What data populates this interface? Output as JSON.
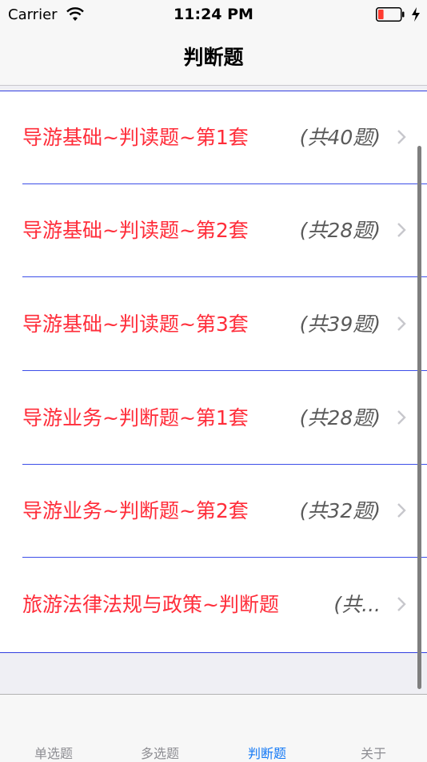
{
  "status_bar": {
    "carrier": "Carrier",
    "time": "11:24 PM",
    "battery_level": 0.25,
    "battery_color": "#ff3b30"
  },
  "nav": {
    "title": "判断题"
  },
  "list": {
    "items": [
      {
        "title": "导游基础~判读题~第1套",
        "count": "(共40题)"
      },
      {
        "title": "导游基础~判读题~第2套",
        "count": "(共28题)"
      },
      {
        "title": "导游基础~判读题~第3套",
        "count": "(共39题)"
      },
      {
        "title": "导游业务~判断题~第1套",
        "count": "(共28题)"
      },
      {
        "title": "导游业务~判断题~第2套",
        "count": "(共32题)"
      },
      {
        "title": "旅游法律法规与政策~判断题",
        "count": "(共..."
      }
    ]
  },
  "tabs": [
    {
      "label": "单选题",
      "active": false
    },
    {
      "label": "多选题",
      "active": false
    },
    {
      "label": "判断题",
      "active": true
    },
    {
      "label": "关于",
      "active": false
    }
  ],
  "colors": {
    "title_red": "#ff2d3a",
    "separator_blue": "#3d4fe8",
    "tab_active": "#1479f6",
    "tab_inactive": "#8e8e93"
  }
}
